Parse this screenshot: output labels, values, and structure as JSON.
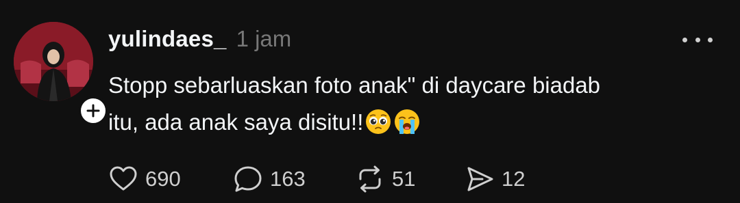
{
  "post": {
    "username": "yulindaes_",
    "timestamp": "1 jam",
    "text_line1": "Stopp sebarluaskan foto anak\" di daycare biadab",
    "text_line2": "itu, ada anak saya disitu!!",
    "emojis": [
      "pleading-face-emoji",
      "loudly-crying-face-emoji"
    ]
  },
  "actions": {
    "likes": "690",
    "replies": "163",
    "reposts": "51",
    "shares": "12"
  },
  "icons": {
    "like": "heart-icon",
    "reply": "speech-bubble-icon",
    "repost": "repost-icon",
    "share": "send-icon",
    "more": "more-dots-icon",
    "follow": "plus-icon"
  },
  "colors": {
    "background": "#101010",
    "text": "#f3f5f7",
    "muted": "#777777"
  }
}
